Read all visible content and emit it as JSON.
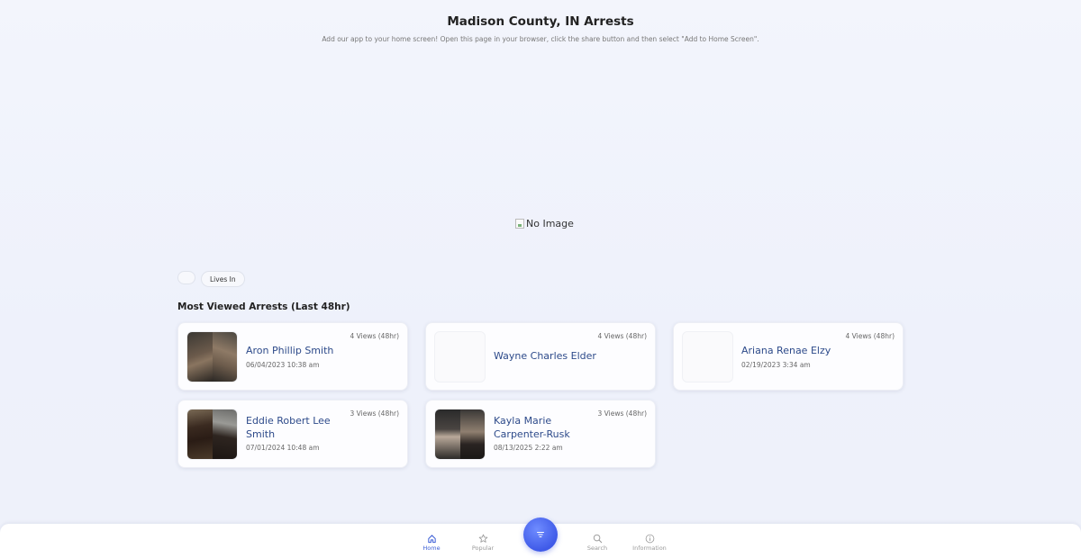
{
  "header": {
    "title": "Madison County, IN Arrests",
    "subtitle": "Add our app to your home screen! Open this page in your browser, click the share button and then select \"Add to Home Screen\"."
  },
  "banner": {
    "alt_text": "No Image"
  },
  "filters": {
    "chip_label": "Lives In"
  },
  "section": {
    "title": "Most Viewed Arrests (Last 48hr)"
  },
  "cards": [
    {
      "name": "Aron Phillip Smith",
      "date": "06/04/2023 10:38 am",
      "views": "4 Views (48hr)",
      "has_photo": true
    },
    {
      "name": "Wayne Charles Elder",
      "date": "",
      "views": "4 Views (48hr)",
      "has_photo": false
    },
    {
      "name": "Ariana Renae Elzy",
      "date": "02/19/2023 3:34 am",
      "views": "4 Views (48hr)",
      "has_photo": false
    },
    {
      "name": "Eddie Robert Lee Smith",
      "date": "07/01/2024 10:48 am",
      "views": "3 Views (48hr)",
      "has_photo": true
    },
    {
      "name": "Kayla Marie Carpenter-Rusk",
      "date": "08/13/2025 2:22 am",
      "views": "3 Views (48hr)",
      "has_photo": true
    }
  ],
  "nav": {
    "home": "Home",
    "popular": "Popular",
    "search": "Search",
    "information": "Information"
  },
  "colors": {
    "accent": "#3d5fd6",
    "name_link": "#2d4a8a",
    "fab": "#4a66ee"
  },
  "icons": {
    "home": "home-icon",
    "popular": "star-icon",
    "filter": "filter-icon",
    "search": "search-icon",
    "information": "info-icon",
    "broken_image": "broken-image-icon"
  }
}
